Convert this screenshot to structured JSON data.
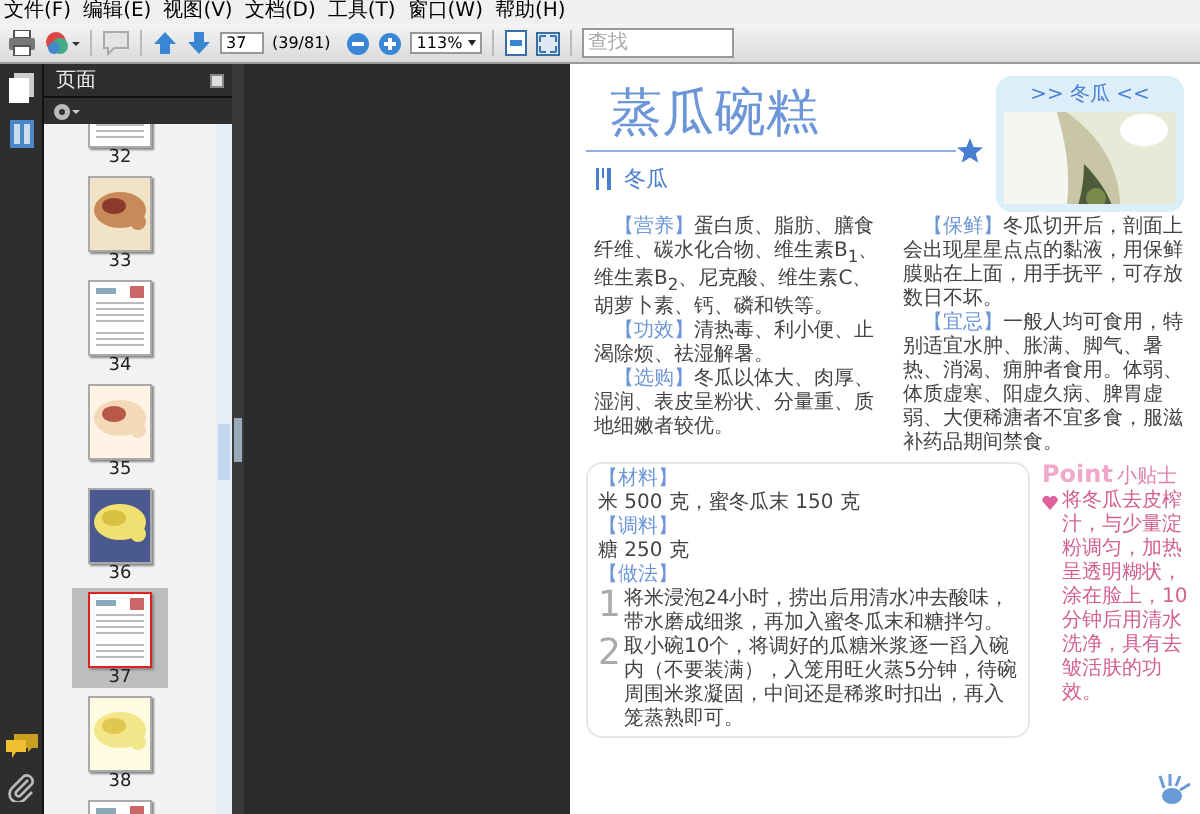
{
  "menu": [
    "文件(F)",
    "编辑(E)",
    "视图(V)",
    "文档(D)",
    "工具(T)",
    "窗口(W)",
    "帮助(H)"
  ],
  "toolbar": {
    "page_field": "37",
    "page_count": "(39/81)",
    "zoom": "113%",
    "search": {
      "placeholder": "查找"
    }
  },
  "sidebar": {
    "title": "页面",
    "thumbnails": [
      {
        "label": "32",
        "kind": "text",
        "selected": false
      },
      {
        "label": "33",
        "selected": false
      },
      {
        "label": "34",
        "kind": "text",
        "selected": false
      },
      {
        "label": "35",
        "selected": false
      },
      {
        "label": "36",
        "selected": false
      },
      {
        "label": "37",
        "kind": "text",
        "selected": true
      },
      {
        "label": "38",
        "selected": false
      },
      {
        "kind": "text",
        "selected": false
      }
    ]
  },
  "page": {
    "badge": ">> 冬瓜 <<",
    "title": "蒸瓜碗糕",
    "subtitle": "冬瓜",
    "intro": [
      {
        "label": "【营养】",
        "text": "蛋白质、脂肪、膳食纤维、碳水化合物、维生素B$_{1}$、维生素B$_{2}$、尼克酸、维生素C、胡萝卜素、钙、磷和铁等。"
      },
      {
        "label": "【功效】",
        "text": "清热毒、利小便、止渴除烦、祛湿解暑。"
      },
      {
        "label": "【选购】",
        "text": "冬瓜以体大、肉厚、湿润、表皮呈粉状、分量重、质地细嫩者较优。"
      },
      {
        "label": "【保鲜】",
        "text": "冬瓜切开后，剖面上会出现星星点点的黏液，用保鲜膜贴在上面，用手抚平，可存放数日不坏。"
      },
      {
        "label": "【宜忌】",
        "text": "一般人均可食用，特别适宜水肿、胀满、脚气、暑热、消渴、痈肿者食用。体弱、体质虚寒、阳虚久病、脾胃虚弱、大便稀溏者不宜多食，服滋补药品期间禁食。"
      }
    ],
    "sections": [
      {
        "heading": "【材料】",
        "text": "米 500 克，蜜冬瓜末 150 克"
      },
      {
        "heading": "【调料】",
        "text": "糖 250 克"
      },
      {
        "heading": "【做法】"
      }
    ],
    "steps": [
      {
        "number": "1",
        "text": "将米浸泡24小时，捞出后用清水冲去酸味，带水磨成细浆，再加入蜜冬瓜末和糖拌匀。"
      },
      {
        "number": "2",
        "text": "取小碗10个，将调好的瓜糖米浆逐一舀入碗内（不要装满），入笼用旺火蒸5分钟，待碗周围米浆凝固，中间还是稀浆时扣出，再入笼蒸熟即可。"
      }
    ],
    "point": {
      "title": "Point",
      "subtitle": "小贴士",
      "text": "将冬瓜去皮榨汁，与少量淀粉调匀，加热呈透明糊状，涂在脸上，10分钟后用清水洗净，具有去皱活肤的功效。"
    }
  }
}
